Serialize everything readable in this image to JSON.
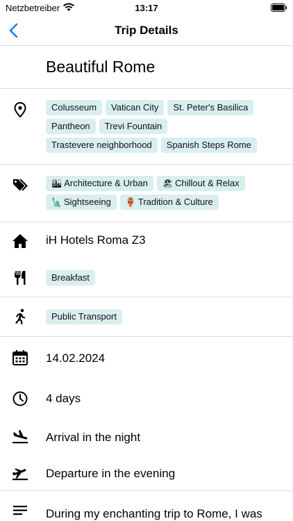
{
  "status_bar": {
    "carrier": "Netzbetreiber",
    "time": "13:17"
  },
  "nav": {
    "title": "Trip Details"
  },
  "trip": {
    "title": "Beautiful Rome",
    "places": [
      "Colusseum",
      "Vatican City",
      "St. Peter's Basilica",
      "Pantheon",
      "Trevi Fountain",
      "Trastevere neighborhood",
      "Spanish Steps Rome"
    ],
    "tags": [
      {
        "emoji": "🏙",
        "label": "Architecture & Urban"
      },
      {
        "emoji": "🏖",
        "label": "Chillout & Relax"
      },
      {
        "emoji": "🗽",
        "label": "Sightseeing"
      },
      {
        "emoji": "🏺",
        "label": "Tradition & Culture"
      }
    ],
    "hotel": "iH Hotels Roma Z3",
    "meals": [
      "Breakfast"
    ],
    "transport": [
      "Public Transport"
    ],
    "date": "14.02.2024",
    "duration": "4 days",
    "arrival": "Arrival in the night",
    "departure": "Departure in the evening",
    "description": "During my enchanting trip to Rome, I was"
  },
  "colors": {
    "accent": "#1a7cf5",
    "chip_bg": "#d9eeef"
  }
}
